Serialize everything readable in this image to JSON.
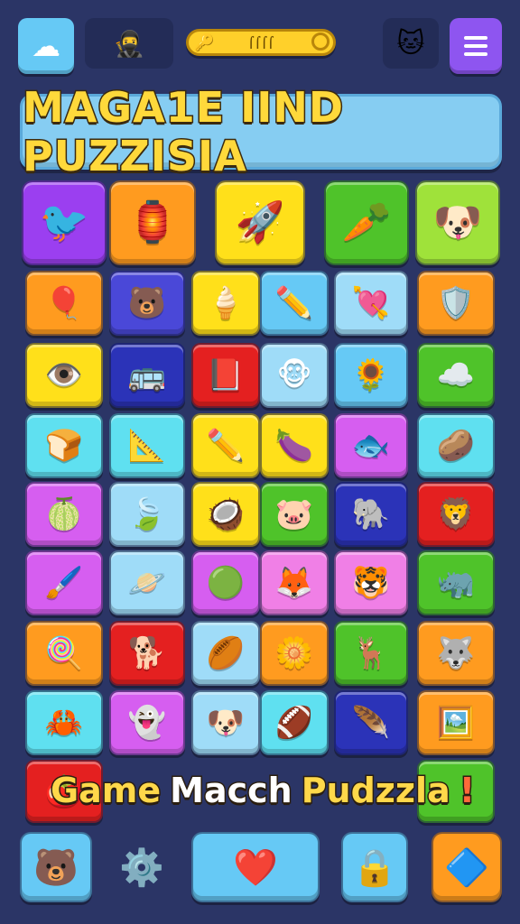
{
  "header": {
    "cloud_button_icon": "cloud-icon",
    "avatar_icon": "ninja-character-icon",
    "progress_icon": "key-progress-icon",
    "progress_label": "⌠⌠⌠⌠",
    "pet_icon": "pet-character-icon",
    "menu_icon": "hamburger-menu-icon"
  },
  "title": {
    "text": "MAGA1E IIND PUZZISIA"
  },
  "subtitle": {
    "word1": "Game",
    "word2": "Macch",
    "word3": "Pudzzla",
    "mark": "!"
  },
  "colors": {
    "background": "#2b3566",
    "purple": "#9b3ff0",
    "orange": "#ff9b1f",
    "yellow": "#ffe01a",
    "green": "#4fc32a",
    "lime": "#9fe23a",
    "skyblue": "#66c9f5",
    "cyan": "#5fe0f0",
    "blue": "#4a48d8",
    "navy": "#2b33b8",
    "red": "#e42020",
    "magenta": "#d65ef0",
    "pink": "#f07fe6",
    "lightblue": "#9fdcf8"
  },
  "top_row": [
    {
      "icon": "bird-icon",
      "glyph": "🐦",
      "color": "#9b3ff0"
    },
    {
      "icon": "lantern-icon",
      "glyph": "🏮",
      "color": "#ff9b1f"
    },
    {
      "icon": "rocket-icon",
      "glyph": "🚀",
      "color": "#ffe01a"
    },
    {
      "icon": "carrot-icon",
      "glyph": "🥕",
      "color": "#4fc32a"
    },
    {
      "icon": "puppy-icon",
      "glyph": "🐶",
      "color": "#9fe23a"
    }
  ],
  "grid": [
    [
      {
        "icon": "balloon-icon",
        "glyph": "🎈",
        "color": "#ff9b1f"
      },
      {
        "icon": "bear-icon",
        "glyph": "🐻",
        "color": "#4a48d8"
      },
      {
        "icon": "ice-cream-icon",
        "glyph": "🍦",
        "color": "#ffe01a"
      },
      {
        "icon": "pencil-icon",
        "glyph": "✏️",
        "color": "#66c9f5"
      },
      {
        "icon": "heart-arrow-icon",
        "glyph": "💘",
        "color": "#9fdcf8"
      },
      {
        "icon": "shield-icon",
        "glyph": "🛡️",
        "color": "#ff9b1f"
      }
    ],
    [
      {
        "icon": "eye-icon",
        "glyph": "👁️",
        "color": "#ffe01a"
      },
      {
        "icon": "bus-icon",
        "glyph": "🚌",
        "color": "#2b33b8"
      },
      {
        "icon": "book-icon",
        "glyph": "📕",
        "color": "#e42020"
      },
      {
        "icon": "monkey-icon",
        "glyph": "🐵",
        "color": "#9fdcf8"
      },
      {
        "icon": "sun-flower-icon",
        "glyph": "🌻",
        "color": "#66c9f5"
      },
      {
        "icon": "cloud-face-icon",
        "glyph": "☁️",
        "color": "#4fc32a"
      }
    ],
    [
      {
        "icon": "bread-icon",
        "glyph": "🍞",
        "color": "#5fe0f0"
      },
      {
        "icon": "ruler-icon",
        "glyph": "📐",
        "color": "#5fe0f0"
      },
      {
        "icon": "pencil-icon",
        "glyph": "✏️",
        "color": "#ffe01a"
      },
      {
        "icon": "eggplant-icon",
        "glyph": "🍆",
        "color": "#ffe01a"
      },
      {
        "icon": "fish-icon",
        "glyph": "🐟",
        "color": "#d65ef0"
      },
      {
        "icon": "potato-icon",
        "glyph": "🥔",
        "color": "#5fe0f0"
      }
    ],
    [
      {
        "icon": "lime-icon",
        "glyph": "🍈",
        "color": "#d65ef0"
      },
      {
        "icon": "leaf-icon",
        "glyph": "🍃",
        "color": "#9fdcf8"
      },
      {
        "icon": "coconut-face-icon",
        "glyph": "🥥",
        "color": "#ffe01a"
      },
      {
        "icon": "pig-face-icon",
        "glyph": "🐷",
        "color": "#4fc32a"
      },
      {
        "icon": "elephant-icon",
        "glyph": "🐘",
        "color": "#2b33b8"
      },
      {
        "icon": "lion-icon",
        "glyph": "🦁",
        "color": "#e42020"
      }
    ],
    [
      {
        "icon": "brush-icon",
        "glyph": "🖌️",
        "color": "#d65ef0"
      },
      {
        "icon": "planet-icon",
        "glyph": "🪐",
        "color": "#9fdcf8"
      },
      {
        "icon": "green-ball-icon",
        "glyph": "🟢",
        "color": "#d65ef0"
      },
      {
        "icon": "fox-icon",
        "glyph": "🦊",
        "color": "#f07fe6"
      },
      {
        "icon": "tiger-icon",
        "glyph": "🐯",
        "color": "#f07fe6"
      },
      {
        "icon": "rhino-icon",
        "glyph": "🦏",
        "color": "#4fc32a"
      }
    ],
    [
      {
        "icon": "lollipop-icon",
        "glyph": "🍭",
        "color": "#ff9b1f"
      },
      {
        "icon": "dog-icon",
        "glyph": "🐕",
        "color": "#e42020"
      },
      {
        "icon": "rugby-ball-icon",
        "glyph": "🏉",
        "color": "#9fdcf8"
      },
      {
        "icon": "flower-icon",
        "glyph": "🌼",
        "color": "#ff9b1f"
      },
      {
        "icon": "deer-icon",
        "glyph": "🦌",
        "color": "#4fc32a"
      },
      {
        "icon": "wolf-icon",
        "glyph": "🐺",
        "color": "#ff9b1f"
      }
    ],
    [
      {
        "icon": "crab-icon",
        "glyph": "🦀",
        "color": "#5fe0f0"
      },
      {
        "icon": "ghost-icon",
        "glyph": "👻",
        "color": "#d65ef0"
      },
      {
        "icon": "puppy-face-icon",
        "glyph": "🐶",
        "color": "#9fdcf8"
      },
      {
        "icon": "football-icon",
        "glyph": "🏈",
        "color": "#5fe0f0"
      },
      {
        "icon": "feather-icon",
        "glyph": "🪶",
        "color": "#2b33b8"
      },
      {
        "icon": "picture-icon",
        "glyph": "🖼️",
        "color": "#ff9b1f"
      }
    ]
  ],
  "bottom_edge_tiles": [
    {
      "icon": "tomato-icon",
      "glyph": "🍅",
      "color": "#e42020"
    },
    {
      "icon": "green-tile-icon",
      "glyph": "",
      "color": "#4fc32a"
    }
  ],
  "bottom_bar": [
    {
      "icon": "bear-face-icon",
      "glyph": "🐻",
      "color": "#66c9f5"
    },
    {
      "icon": "gear-icon",
      "glyph": "⚙️",
      "color": "transparent"
    },
    {
      "icon": "heart-icon",
      "glyph": "❤️",
      "color": "#66c9f5"
    },
    {
      "icon": "lock-icon",
      "glyph": "🔒",
      "color": "#66c9f5"
    },
    {
      "icon": "star-badge-icon",
      "glyph": "🔷",
      "color": "#ff9b1f"
    }
  ]
}
